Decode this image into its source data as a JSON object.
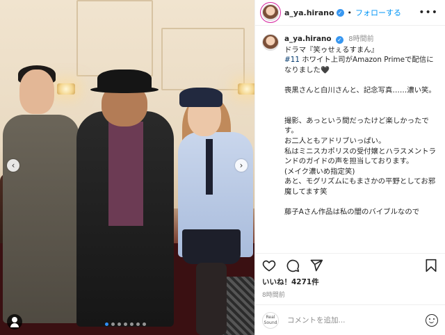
{
  "post": {
    "username": "a_ya.hirano",
    "follow_label": "フォローする",
    "separator": "•",
    "more_label": "•••",
    "time": "8時間前",
    "caption_lines": [
      "ドラマ『笑ゥせぇるすまん』",
      "ホワイト上司がAmazon Primeで配信になりました🖤",
      "",
      "喪黒さんと白川さんと、記念写真……濃い笑。",
      "",
      "",
      "撮影、あっという間だったけど楽しかったです。",
      "お二人ともアドリブいっぱい。",
      "私はミニスカポリスの受付嬢とハラスメントランドのガイドの声を担当しております。",
      "(メイク濃いめ指定笑)",
      "あと、モグリズムにもまさかの平野としてお邪魔してます笑",
      "",
      "藤子Aさん作品は私の闇のバイブルなので"
    ],
    "hashtag": "#11",
    "likes_label": "いいね！4271件",
    "posted_time": "8時間前"
  },
  "comment_bar": {
    "logo_text": "Real Sound",
    "placeholder": "コメントを追加..."
  },
  "carousel": {
    "prev_icon": "‹",
    "next_icon": "›",
    "total_slides": 7,
    "active_slide": 1
  },
  "icons": {
    "like": "heart-icon",
    "comment": "comment-icon",
    "share": "send-icon",
    "save": "bookmark-icon",
    "verified": "verified-badge-icon"
  },
  "colors": {
    "link_blue": "#0095f6",
    "verified_blue": "#3897f0",
    "hashtag": "#00376b",
    "meta_gray": "#8e8e8e"
  }
}
